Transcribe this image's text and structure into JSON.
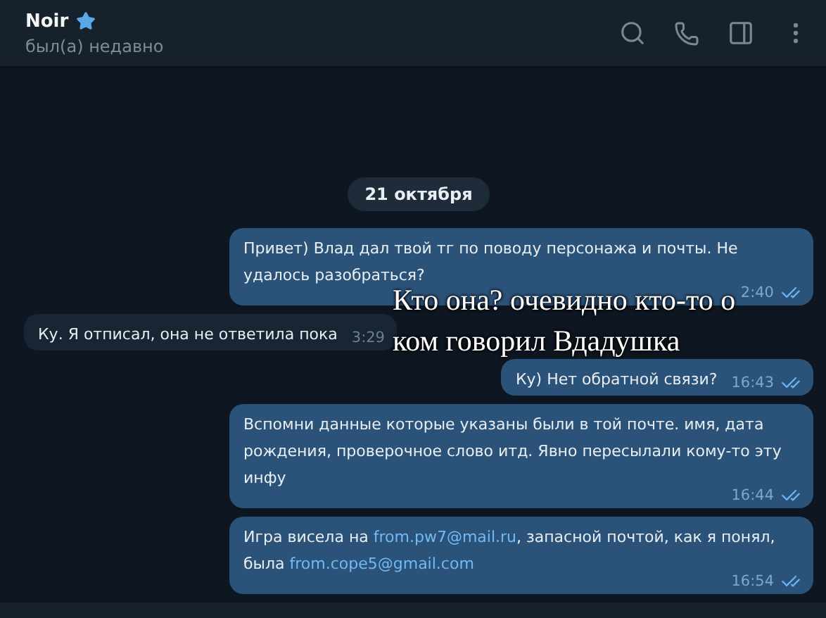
{
  "header": {
    "name": "Noir",
    "starred": true,
    "status": "был(а) недавно"
  },
  "date_badge": "21 октября",
  "messages": [
    {
      "outgoing": true,
      "parts": [
        {
          "kind": "text",
          "text": "Привет) Влад дал твой тг по поводу персонажа и почты. Не удалось разобраться?"
        }
      ],
      "time": "2:40",
      "read": true
    },
    {
      "outgoing": false,
      "parts": [
        {
          "kind": "text",
          "text": "Ку. Я отписал, она не ответила пока"
        }
      ],
      "time": "3:29"
    },
    {
      "outgoing": true,
      "parts": [
        {
          "kind": "text",
          "text": "Ку) Нет обратной связи?"
        }
      ],
      "time": "16:43",
      "read": true
    },
    {
      "outgoing": true,
      "parts": [
        {
          "kind": "text",
          "text": "Вспомни данные которые указаны были в той почте. имя, дата рождения, проверочное слово итд. Явно пересылали кому-то эту инфу"
        }
      ],
      "time": "16:44",
      "read": true
    },
    {
      "outgoing": true,
      "parts": [
        {
          "kind": "text",
          "text": "Игра висела на "
        },
        {
          "kind": "link",
          "text": "from.pw7@mail.ru"
        },
        {
          "kind": "text",
          "text": ", запасной почтой, как я понял, была "
        },
        {
          "kind": "link",
          "text": "from.cope5@gmail.com"
        }
      ],
      "time": "16:54",
      "read": true
    }
  ],
  "caption": [
    "Кто она? очевидно кто-то о",
    "ком говорил Вдадушка"
  ]
}
